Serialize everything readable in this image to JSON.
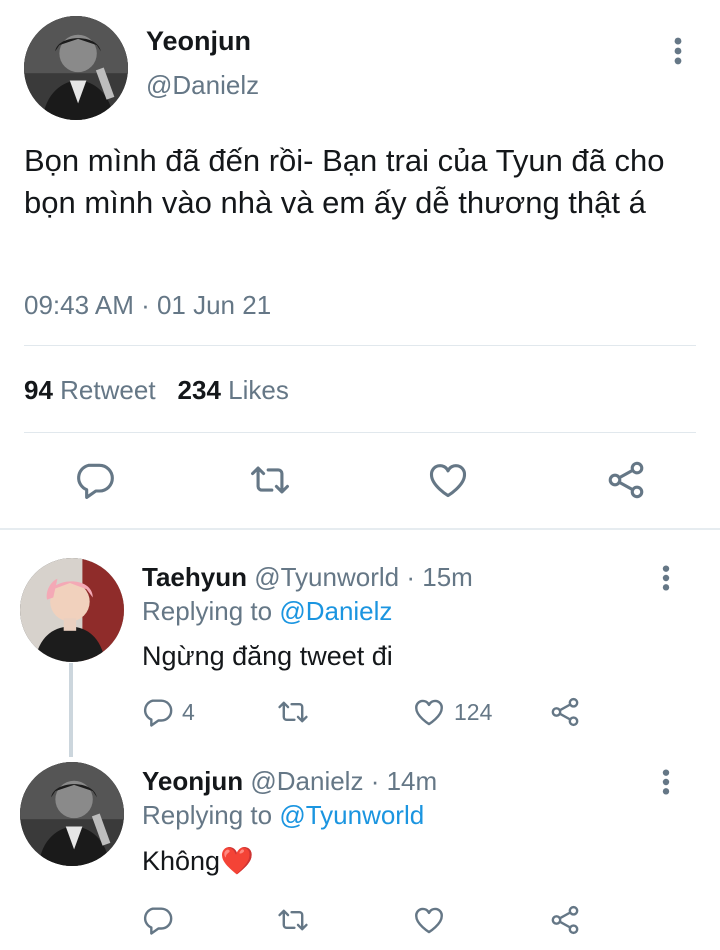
{
  "main_tweet": {
    "name": "Yeonjun",
    "handle": "@Danielz",
    "text": "Bọn mình đã đến rồi- Bạn trai của Tyun đã cho bọn mình vào nhà và em ấy dễ thương thật á",
    "timestamp": "09:43 AM · 01 Jun 21",
    "retweet_count": "94",
    "retweet_label": "Retweet",
    "like_count": "234",
    "like_label": "Likes"
  },
  "replies": [
    {
      "name": "Taehyun",
      "handle": "@Tyunworld",
      "time": "· 15m",
      "replying_label": "Replying to",
      "replying_to": "@Danielz",
      "text": "Ngừng đăng tweet đi",
      "reply_count": "4",
      "like_count": "124"
    },
    {
      "name": "Yeonjun",
      "handle": "@Danielz",
      "time": "· 14m",
      "replying_label": "Replying to",
      "replying_to": "@Tyunworld",
      "text": "Không❤️",
      "reply_count": "",
      "like_count": ""
    }
  ],
  "icons": {
    "reply": "reply-icon",
    "retweet": "retweet-icon",
    "like": "heart-icon",
    "share": "share-icon",
    "more": "more-vertical-icon"
  },
  "colors": {
    "text": "#14171a",
    "secondary": "#657786",
    "link": "#1b95e0",
    "divider": "#e1e8ed"
  }
}
